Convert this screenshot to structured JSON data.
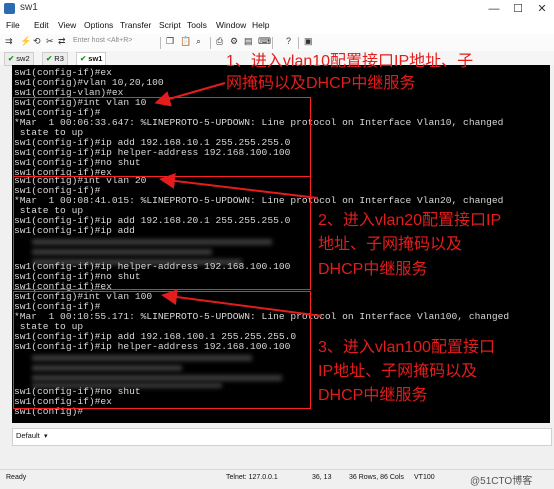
{
  "window": {
    "title": "sw1",
    "minimize": "—",
    "maximize": "☐",
    "close": "✕"
  },
  "menu": [
    "File",
    "Edit",
    "View",
    "Options",
    "Transfer",
    "Script",
    "Tools",
    "Window",
    "Help"
  ],
  "toolbar": {
    "host_placeholder": "Enter host <Alt+R>"
  },
  "tabs": [
    "sw2",
    "R3",
    "sw1"
  ],
  "terminal": {
    "lines": [
      "sw1(config-if)#ex",
      "sw1(config)#vlan 10,20,100",
      "sw1(config-vlan)#ex",
      "sw1(config)#int vlan 10",
      "sw1(config-if)#",
      "*Mar  1 00:06:33.647: %LINEPROTO-5-UPDOWN: Line protocol on Interface Vlan10, changed",
      " state to up",
      "sw1(config-if)#ip add 192.168.10.1 255.255.255.0",
      "sw1(config-if)#ip helper-address 192.168.100.100",
      "sw1(config-if)#no shut",
      "sw1(config-if)#ex",
      "sw1(config)#int vlan 20",
      "sw1(config-if)#",
      "*Mar  1 00:08:41.015: %LINEPROTO-5-UPDOWN: Line protocol on Interface Vlan20, changed",
      " state to up",
      "sw1(config-if)#ip add 192.168.20.1 255.255.255.0",
      "sw1(config-if)#ip add",
      "",
      "",
      "",
      "sw1(config-if)#ip helper-address 192.168.100.100",
      "sw1(config-if)#no shut",
      "sw1(config-if)#ex",
      "sw1(config)#int vlan 100",
      "sw1(config-if)#",
      "*Mar  1 00:10:55.171: %LINEPROTO-5-UPDOWN: Line protocol on Interface Vlan100, changed",
      " state to up",
      "sw1(config-if)#ip add 192.168.100.1 255.255.255.0",
      "sw1(config-if)#ip helper-address 192.168.100.100",
      "",
      "",
      "",
      "",
      "sw1(config-if)#no shut",
      "sw1(config-if)#ex",
      "sw1(config)#"
    ]
  },
  "annotations": {
    "a1_line1": "1、进入vlan10配置接口IP地址、子",
    "a1_line2": "网掩码以及DHCP中继服务",
    "a2_line1": "2、进入vlan20配置接口IP",
    "a2_line2": "地址、子网掩码以及",
    "a2_line3": "DHCP中继服务",
    "a3_line1": "3、进入vlan100配置接口",
    "a3_line2": "IP地址、子网掩码以及",
    "a3_line3": "DHCP中继服务"
  },
  "command_bar": {
    "label": "Default"
  },
  "status": {
    "ready": "Ready",
    "connection": "Telnet: 127.0.0.1",
    "cursor": "36,  13",
    "size": "36 Rows, 86 Cols",
    "terminal_type": "VT100",
    "watermark": "@51CTO博客"
  },
  "colors": {
    "annotation": "#e51c1c",
    "terminal_bg": "#000000",
    "terminal_fg": "#d8d8d8"
  }
}
